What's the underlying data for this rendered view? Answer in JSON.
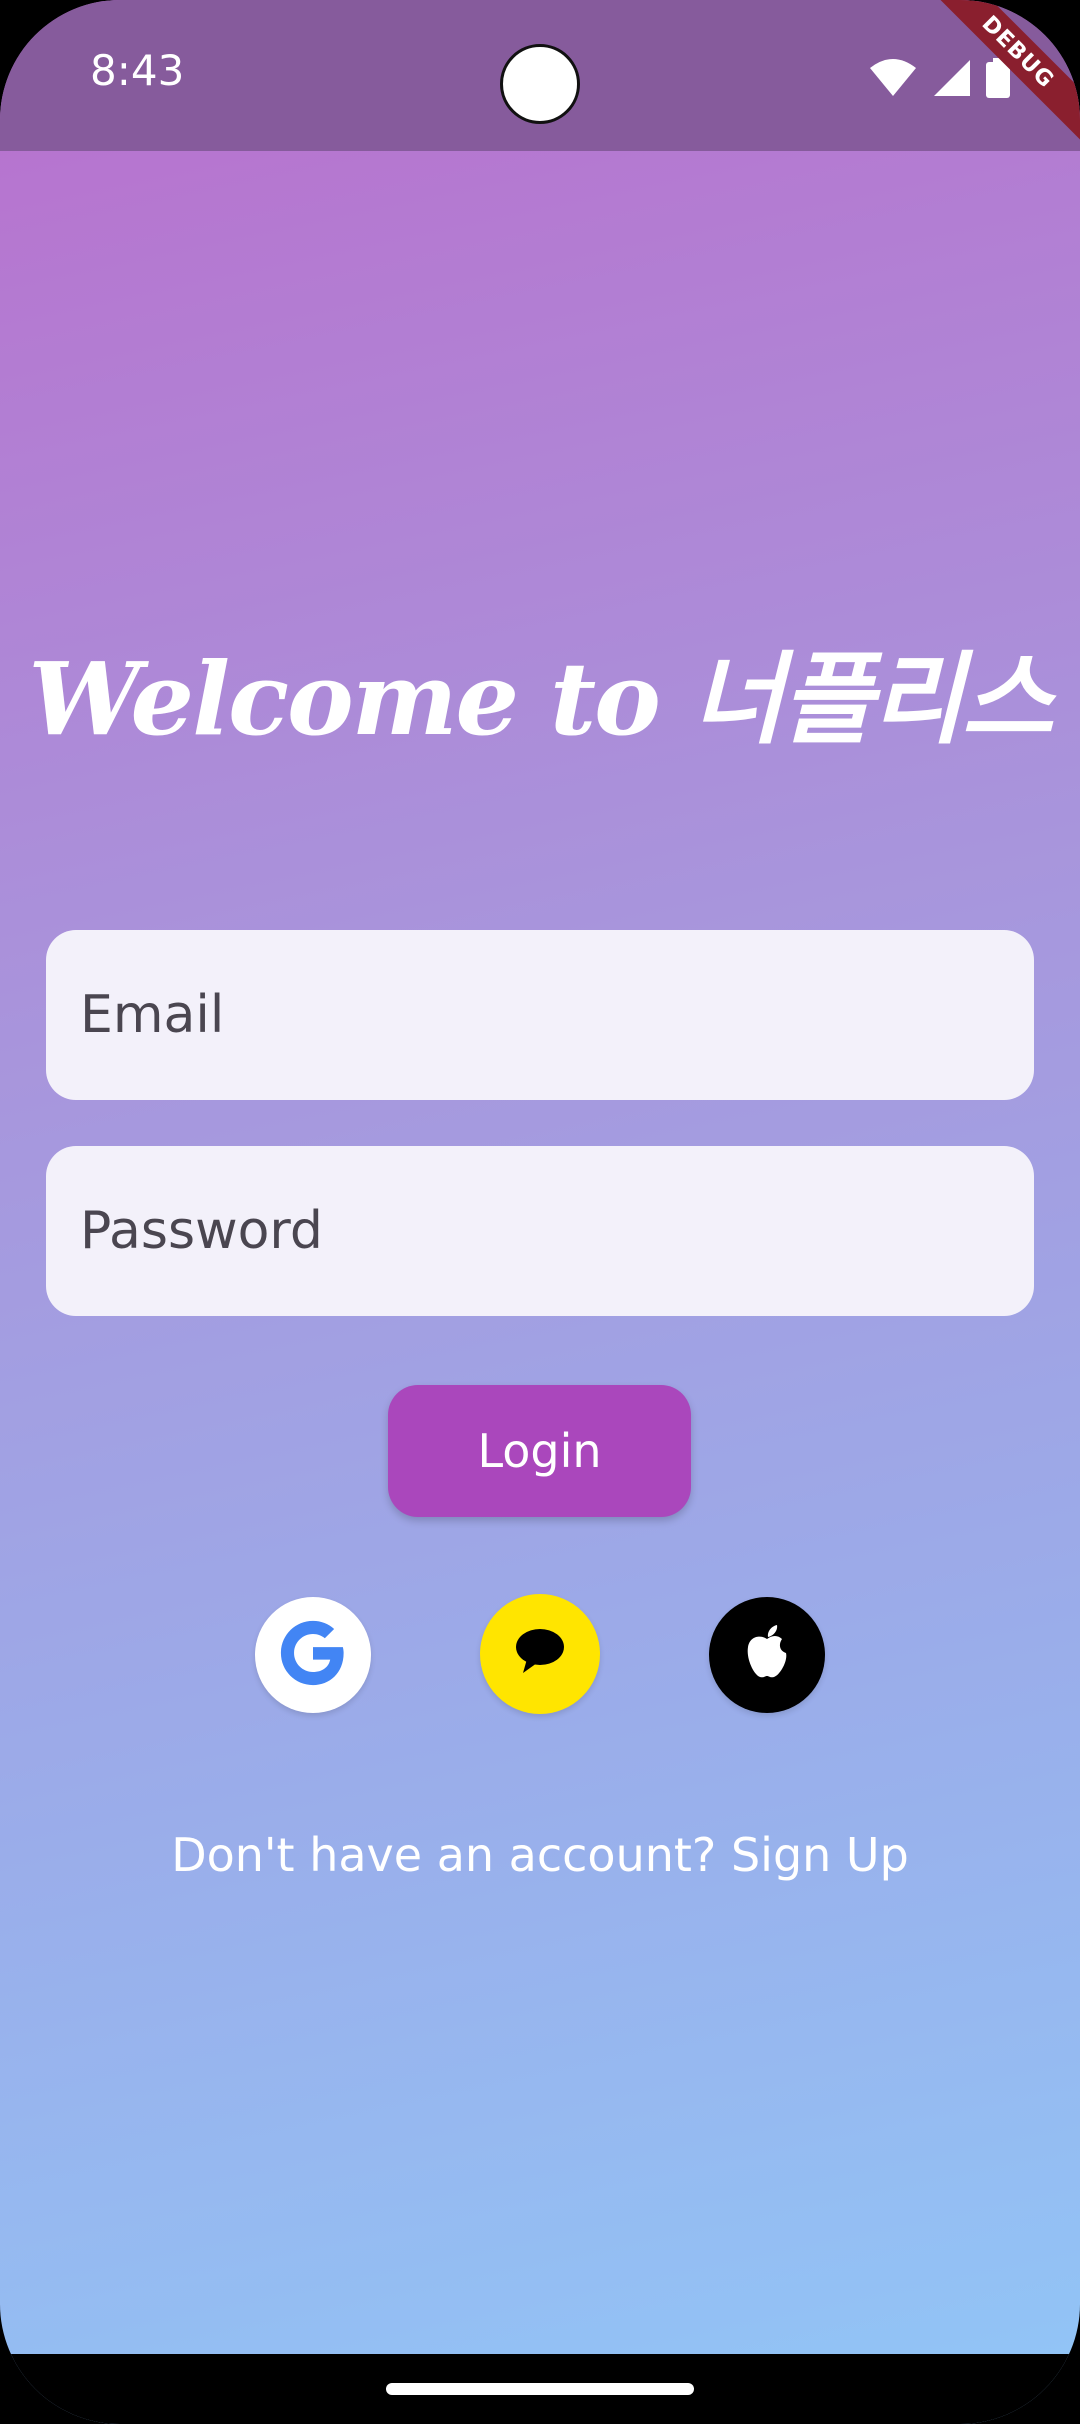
{
  "status_bar": {
    "time": "8:43",
    "icons": [
      "wifi-icon",
      "signal-icon",
      "battery-icon"
    ],
    "debug_label": "DEBUG"
  },
  "welcome": {
    "title": "Welcome to 너플리스"
  },
  "form": {
    "email_placeholder": "Email",
    "password_placeholder": "Password",
    "login_label": "Login"
  },
  "social": {
    "buttons": [
      {
        "name": "google",
        "icon": "google-icon",
        "color": "#ffffff"
      },
      {
        "name": "kakao",
        "icon": "kakao-talk-icon",
        "color": "#ffe500"
      },
      {
        "name": "apple",
        "icon": "apple-icon",
        "color": "#000000"
      }
    ],
    "google_letter": "G"
  },
  "signup": {
    "text": "Don't have an account? Sign Up"
  },
  "colors": {
    "status_bar": "#865b9c",
    "gradient_top": "#b96fcd",
    "gradient_bottom": "#91c6f7",
    "login_button": "#aa47bc",
    "input_bg": "#f3f1fa"
  }
}
